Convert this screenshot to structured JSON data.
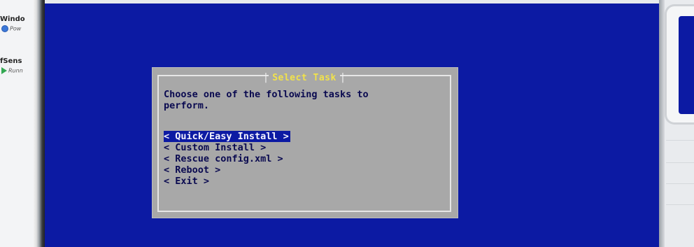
{
  "host": {
    "vms": [
      {
        "name": "Windo",
        "state": "Pow",
        "state_icon": "power-icon"
      },
      {
        "name": "fSens",
        "state": "Runn",
        "state_icon": "running-play-icon"
      }
    ]
  },
  "colors": {
    "console_bg": "#0c1aa3",
    "dialog_bg": "#a8a8a8",
    "title_text": "#f1e24a",
    "highlight_bg": "#0c1aa3"
  },
  "dialog": {
    "title": "Select Task",
    "prompt": "Choose one of the following tasks to\nperform.",
    "options": [
      {
        "label": "< Quick/Easy Install >",
        "selected": true
      },
      {
        "label": "< Custom Install >",
        "selected": false
      },
      {
        "label": "< Rescue config.xml >",
        "selected": false
      },
      {
        "label": "< Reboot >",
        "selected": false
      },
      {
        "label": "< Exit >",
        "selected": false
      }
    ]
  }
}
